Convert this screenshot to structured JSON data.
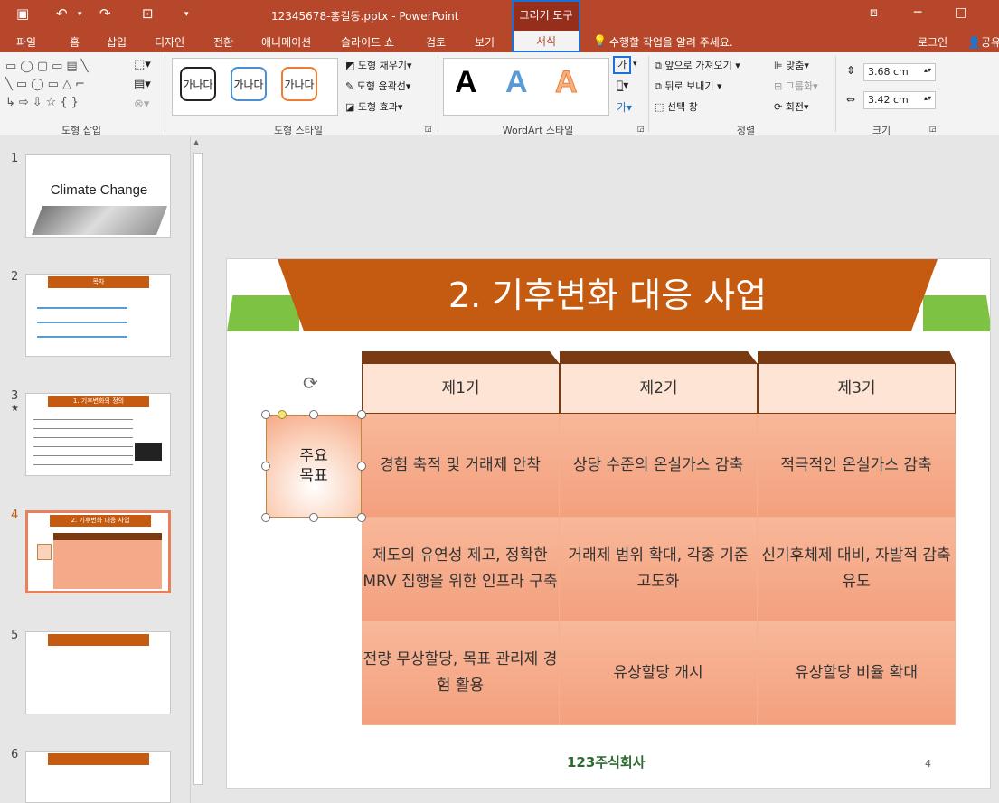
{
  "window": {
    "title": "12345678-홍길동.pptx - PowerPoint",
    "context_tab_group": "그리기 도구"
  },
  "menu": {
    "tabs": [
      "파일",
      "홈",
      "삽입",
      "디자인",
      "전환",
      "애니메이션",
      "슬라이드 쇼",
      "검토",
      "보기"
    ],
    "active_tab": "서식",
    "tell_me": "수행할 작업을 알려 주세요.",
    "login": "로그인",
    "share": "공유"
  },
  "ribbon": {
    "groups": {
      "insert_shapes": "도형 삽입",
      "shape_styles": "도형 스타일",
      "wordart_styles": "WordArt 스타일",
      "arrange": "정렬",
      "size": "크기"
    },
    "shape_style_sample": "가나다",
    "fill": "도형 채우기",
    "outline": "도형 윤곽선",
    "effects": "도형 효과",
    "wordart_sample": "A",
    "text_fill_icon": "가",
    "bring_forward": "앞으로 가져오기",
    "send_backward": "뒤로 보내기",
    "selection_pane": "선택 창",
    "align": "맞춤",
    "group": "그룹화",
    "rotate": "회전",
    "height": "3.68 cm",
    "width": "3.42 cm"
  },
  "thumbnails": [
    {
      "num": "1",
      "text": "Climate Change"
    },
    {
      "num": "2",
      "text": "목차"
    },
    {
      "num": "3",
      "text": "1. 기후변화의 정의"
    },
    {
      "num": "4",
      "text": "2. 기후변화 대응 사업"
    },
    {
      "num": "5",
      "text": ""
    },
    {
      "num": "6",
      "text": ""
    }
  ],
  "slide": {
    "title": "2. 기후변화 대응 사업",
    "key_label_line1": "주요",
    "key_label_line2": "목표",
    "headers": [
      "제1기",
      "제2기",
      "제3기"
    ],
    "rows": [
      [
        "경험 축적 및 거래제 안착",
        "상당 수준의 온실가스 감축",
        "적극적인 온실가스 감축"
      ],
      [
        "제도의 유연성 제고, 정확한 MRV 집행을 위한 인프라 구축",
        "거래제 범위 확대, 각종 기준 고도화",
        "신기후체제 대비, 자발적 감축 유도"
      ],
      [
        "전량 무상할당, 목표 관리제 경험 활용",
        "유상할당 개시",
        "유상할당 비율 확대"
      ]
    ],
    "logo": "123주식회사",
    "page_number": "4"
  },
  "colors": {
    "accent": "#b7472a",
    "slide_orange": "#c55a11",
    "green": "#7dc243",
    "selection": "#1e6fd6"
  }
}
